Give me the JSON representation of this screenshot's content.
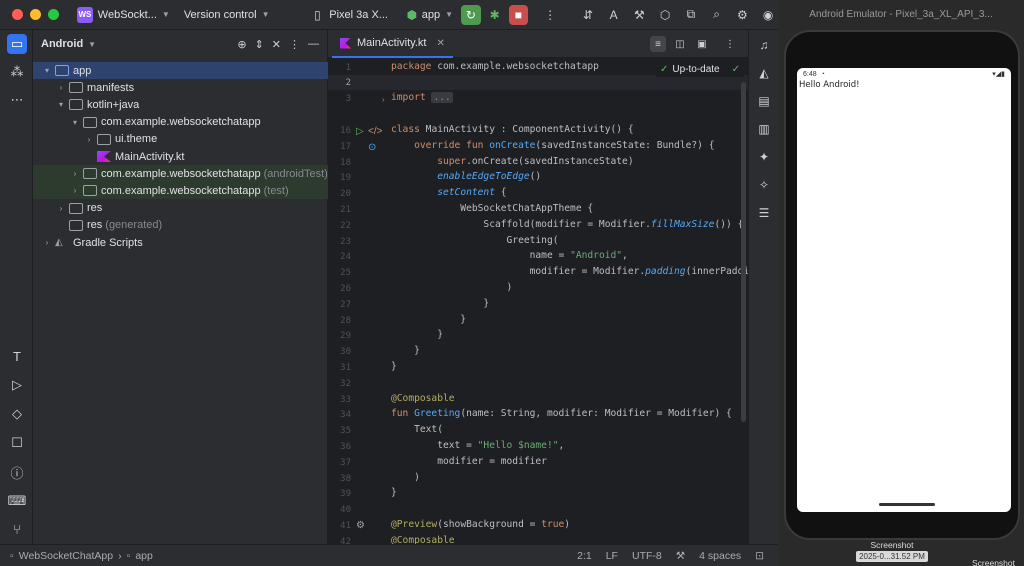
{
  "titlebar": {
    "project_badge": "WS",
    "project_name": "WebSockt...",
    "vcs_label": "Version control",
    "device": "Pixel 3a X...",
    "run_config": "app"
  },
  "project_panel": {
    "view_label": "Android",
    "tree": [
      {
        "label": "app",
        "muted": "",
        "depth": 0,
        "arrow": "▾",
        "icon": "folder-blue",
        "selected": true
      },
      {
        "label": "manifests",
        "muted": "",
        "depth": 1,
        "arrow": "›",
        "icon": "folder"
      },
      {
        "label": "kotlin+java",
        "muted": "",
        "depth": 1,
        "arrow": "▾",
        "icon": "folder"
      },
      {
        "label": "com.example.websocketchatapp",
        "muted": "",
        "depth": 2,
        "arrow": "▾",
        "icon": "folder"
      },
      {
        "label": "ui.theme",
        "muted": "",
        "depth": 3,
        "arrow": "›",
        "icon": "folder"
      },
      {
        "label": "MainActivity.kt",
        "muted": "",
        "depth": 3,
        "arrow": "",
        "icon": "kt"
      },
      {
        "label": "com.example.websocketchatapp",
        "muted": "(androidTest)",
        "depth": 2,
        "arrow": "›",
        "icon": "folder",
        "green": true
      },
      {
        "label": "com.example.websocketchatapp",
        "muted": "(test)",
        "depth": 2,
        "arrow": "›",
        "icon": "folder",
        "green": true
      },
      {
        "label": "res",
        "muted": "",
        "depth": 1,
        "arrow": "›",
        "icon": "folder"
      },
      {
        "label": "res",
        "muted": "(generated)",
        "depth": 1,
        "arrow": "",
        "icon": "folder"
      },
      {
        "label": "Gradle Scripts",
        "muted": "",
        "depth": 0,
        "arrow": "›",
        "icon": "gradle"
      }
    ]
  },
  "editor": {
    "tab_label": "MainActivity.kt",
    "status": "Up-to-date",
    "line_numbers": [
      "1",
      "2",
      "3",
      "16",
      "17",
      "18",
      "19",
      "20",
      "21",
      "22",
      "23",
      "24",
      "25",
      "26",
      "27",
      "28",
      "29",
      "30",
      "31",
      "32",
      "33",
      "34",
      "35",
      "36",
      "37",
      "38",
      "39",
      "40",
      "41",
      "42"
    ],
    "current_line": "2",
    "lines": [
      "<span class='kw'>package</span> com.example.websocketchatapp",
      "",
      "<span class='kw'>import</span> <span class='fold-box'>...</span>",
      "<span class='kw'>class</span> MainActivity : ComponentActivity() {",
      "    <span class='kw'>override fun</span> <span class='fn'>onCreate</span>(savedInstanceState: Bundle?) {",
      "        <span class='kw'>super</span>.onCreate(savedInstanceState)",
      "        <span class='it'>enableEdgeToEdge</span>()",
      "        <span class='it'>setContent</span> {",
      "            WebSocketChatAppTheme {",
      "                Scaffold(modifier = Modifier.<span class='it'>fillMaxSize</span>()) { in",
      "                    Greeting(",
      "                        name = <span class='str'>\"Android\"</span>,",
      "                        modifier = Modifier.<span class='it'>padding</span>(innerPadding",
      "                    )",
      "                }",
      "            }",
      "        }",
      "    }",
      "}",
      "",
      "<span class='ann'>@Composable</span>",
      "<span class='kw'>fun</span> <span class='fn'>Greeting</span>(name: String, modifier: Modifier = Modifier) {",
      "    Text(",
      "        text = <span class='str'>\"Hello $name!\"</span>,",
      "        modifier = modifier",
      "    )",
      "}",
      "",
      "<span class='ann'>@Preview</span>(showBackground = <span class='kw'>true</span>)",
      "<span class='ann'>@Composable</span>"
    ]
  },
  "statusbar": {
    "breadcrumb_project": "WebSocketChatApp",
    "breadcrumb_module": "app",
    "caret": "2:1",
    "line_sep": "LF",
    "encoding": "UTF-8",
    "indent": "4 spaces"
  },
  "emulator": {
    "title": "Android Emulator - Pixel_3a_XL_API_3...",
    "clock": "6:48",
    "app_text": "Hello Android!",
    "screenshot_label": "Screenshot",
    "screenshot_time": "2025-0...31.52 PM",
    "screenshot_label_2": "Screenshot"
  },
  "colors": {
    "accent": "#3574f0",
    "run": "#4e9a4e",
    "stop": "#c94f4f"
  }
}
